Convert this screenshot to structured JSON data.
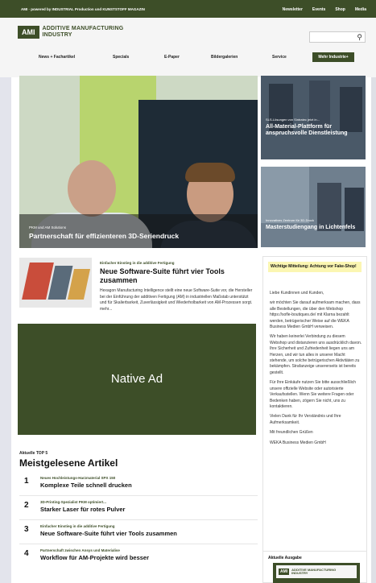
{
  "topbar": {
    "tagline": "AMI · powered by INDUSTRIAL Production und KUNSTSTOFF MAGAZIN",
    "links": [
      "Newsletter",
      "Events",
      "Shop",
      "Media"
    ]
  },
  "header": {
    "logo_box": "AMI",
    "logo_line1": "ADDITIVE MANUFACTURING",
    "logo_line2": "INDUSTRY",
    "search_placeholder": "",
    "search_icon": "search-icon"
  },
  "nav": {
    "items": [
      "News + Fachartikel",
      "Specials",
      "E-Paper",
      "Bildergalerien",
      "Service"
    ],
    "more": "Mehr Industrie+"
  },
  "hero": {
    "kicker": "PKM und AM Solutions",
    "title": "Partnerschaft für effizienteren 3D-Seriendruck"
  },
  "side_cards": [
    {
      "kicker": "SLS-Lösungen von Sintratec jetzt in...",
      "title": "All-Material-Plattform für anspruchsvolle Dienstleistung"
    },
    {
      "kicker": "Innovatives Zentrum für 3D-Druck",
      "title": "Masterstudiengang in Lichtenfels"
    }
  ],
  "article": {
    "kicker": "Einfacher Einstieg in die additive Fertigung",
    "title": "Neue Software-Suite führt vier Tools zusammen",
    "text": "Hexagon Manufacturing Intelligence stellt eine neue Software-Suite vor, die Hersteller bei der Einführung der additiven Fertigung (AM) in industriellen Maßstab unterstützt und für Skalierbarkeit, Zuverlässigkeit und Wiederholbarkeit von AM-Prozessen sorgt. mehr..."
  },
  "native_ad": {
    "label": "Native Ad"
  },
  "top5": {
    "kicker": "Aktuelle TOP 5",
    "title": "Meistgelesene Artikel",
    "items": [
      {
        "num": "1",
        "kicker": "Neues Hochleistungs-Harzmaterial SPX 150",
        "title": "Komplexe Teile schnell drucken"
      },
      {
        "num": "2",
        "kicker": "3D-Printing-Spezialist PKM optimiert...",
        "title": "Starker Laser für rotes Pulver"
      },
      {
        "num": "3",
        "kicker": "Einfacher Einstieg in die additive Fertigung",
        "title": "Neue Software-Suite führt vier Tools zusammen"
      },
      {
        "num": "4",
        "kicker": "Partnerschaft zwischen Ansys und Materialise",
        "title": "Workflow für AM-Projekte wird besser"
      }
    ]
  },
  "notice": {
    "head": "Wichtige Mitteilung: Achtung vor Fake-Shop!",
    "paragraphs": [
      "Liebe Kundinnen und Kunden,",
      "wir möchten Sie darauf aufmerksam machen, dass alle Bestellungen, die über den Webshop https://sofle-boutiques.de/ mit Klarna bezahlt werden, betrügerischer Weise auf die WEKA Business Medien GmbH verweisen.",
      "Wir haben keinerlei Verbindung zu diesem Webshop und distanzieren uns ausdrücklich davon. Ihre Sicherheit und Zufriedenheit liegen uns am Herzen, und wir tun alles in unserer Macht stehende, um solche betrügerischen Aktivitäten zu bekämpfen. Strafanzeige unsererseits ist bereits gestellt.",
      "Für Ihre Einkäufe nutzen Sie bitte ausschließlich unsere offizielle Website oder autorisierte Verkaufsstellen. Wenn Sie weitere Fragen oder Bedenken haben, zögern Sie nicht, uns zu kontaktieren.",
      "Vielen Dank für Ihr Verständnis und Ihre Aufmerksamkeit.",
      "Mit freundlichen Grüßen",
      "WEKA Business Medien GmbH"
    ]
  },
  "issue": {
    "label": "Aktuelle Ausgabe",
    "logo_box": "AMI",
    "logo_line1": "ADDITIVE MANUFACTURING",
    "logo_line2": "INDUSTRY"
  },
  "colors": {
    "brand": "#3d4e28",
    "notice_bg": "#fbf6b2",
    "hero_green": "#b8d46e"
  }
}
